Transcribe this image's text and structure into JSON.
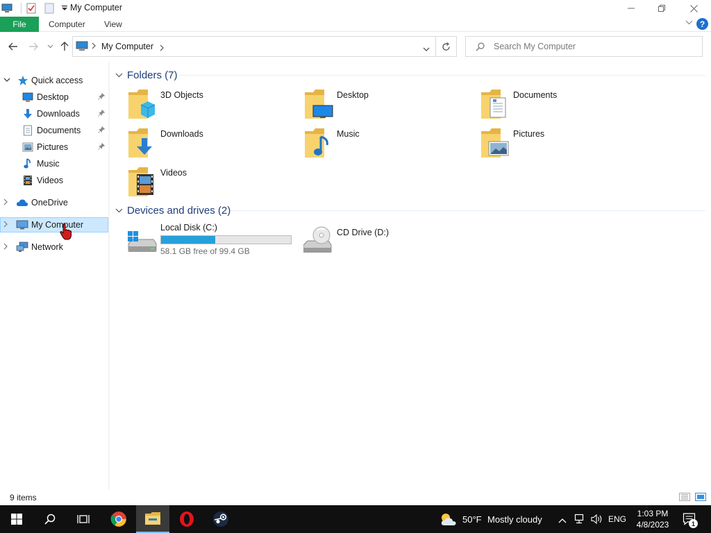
{
  "window": {
    "title": "My Computer"
  },
  "ribbon": {
    "file": "File",
    "computer": "Computer",
    "view": "View",
    "help": "?"
  },
  "address": {
    "path": "My Computer",
    "search_placeholder": "Search My Computer"
  },
  "nav": {
    "quick_access": "Quick access",
    "items": [
      {
        "label": "Desktop"
      },
      {
        "label": "Downloads"
      },
      {
        "label": "Documents"
      },
      {
        "label": "Pictures"
      },
      {
        "label": "Music"
      },
      {
        "label": "Videos"
      }
    ],
    "onedrive": "OneDrive",
    "my_computer": "My Computer",
    "network": "Network"
  },
  "folders": {
    "heading": "Folders (7)",
    "items": [
      {
        "name": "3D Objects"
      },
      {
        "name": "Desktop"
      },
      {
        "name": "Documents"
      },
      {
        "name": "Downloads"
      },
      {
        "name": "Music"
      },
      {
        "name": "Pictures"
      },
      {
        "name": "Videos"
      }
    ]
  },
  "drives": {
    "heading": "Devices and drives (2)",
    "items": [
      {
        "name": "Local Disk (C:)",
        "free_text": "58.1 GB free of 99.4 GB",
        "used_fraction": 0.416
      },
      {
        "name": "CD Drive (D:)"
      }
    ]
  },
  "status": {
    "item_count": "9 items"
  },
  "taskbar": {
    "weather_temp": "50°F",
    "weather_desc": "Mostly cloudy",
    "language": "ENG",
    "time": "1:03 PM",
    "date": "4/8/2023",
    "notification_count": "1"
  },
  "colors": {
    "file_tab": "#1aa058",
    "selection": "#cce8ff",
    "drive_bar": "#26a0da",
    "group_heading": "#1e3d7a",
    "taskbar": "#101010"
  }
}
